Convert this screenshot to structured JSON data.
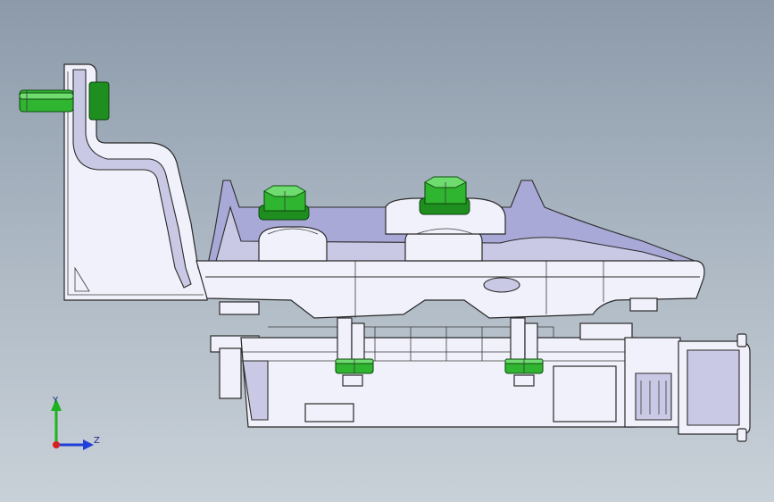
{
  "viewport": {
    "background_top": "#8c9aaa",
    "background_bottom": "#c9d1d8"
  },
  "model": {
    "colors": {
      "part": "#f1f1fb",
      "part_shade": "#c9c9e6",
      "fastener": "#2fb52f",
      "outline": "#2a2a2a"
    }
  },
  "triad": {
    "y_label": "Y",
    "z_label": "Z",
    "y_color": "#1fb21f",
    "z_color": "#1f3fd8",
    "x_color": "#d81f1f"
  }
}
